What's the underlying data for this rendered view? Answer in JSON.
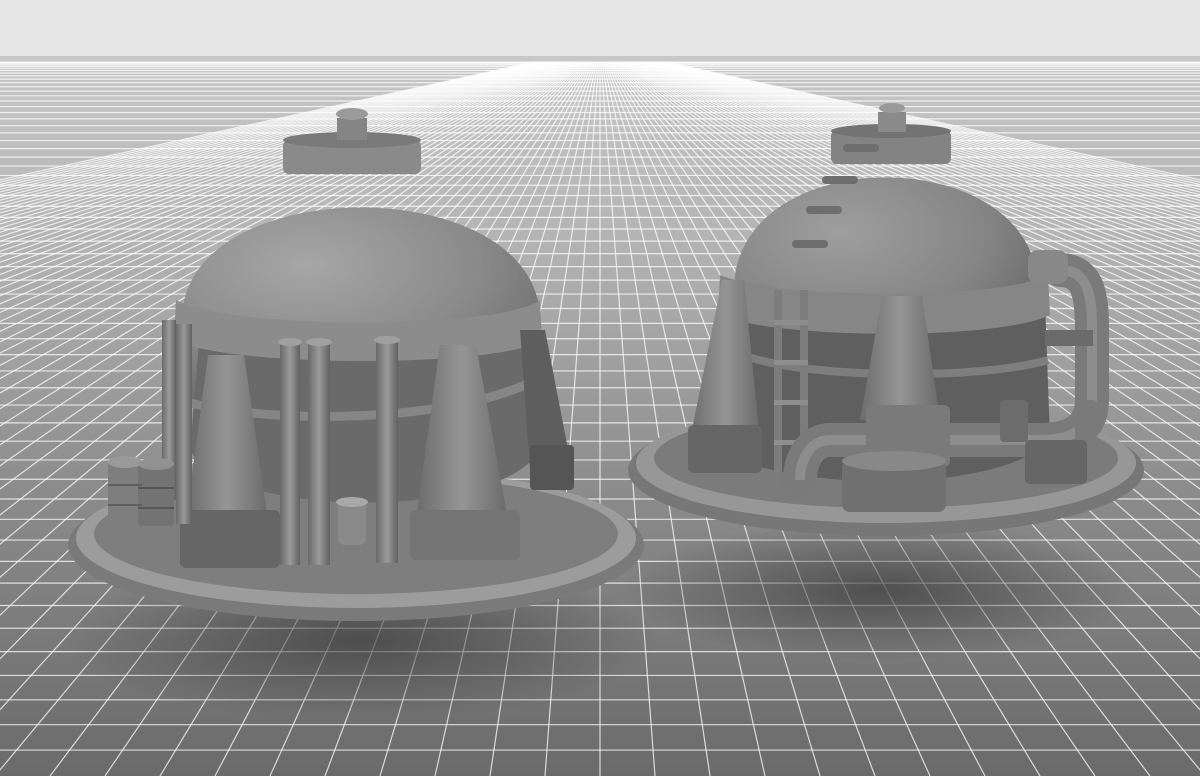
{
  "scene": {
    "subject": "two-spherical-gas-tank-models",
    "objects": [
      "left-tank-model",
      "right-tank-model"
    ],
    "colors": {
      "top_band": "#e6e6e6",
      "horizon": "#c4c4c4",
      "floor_near": "#5a5a5a",
      "grid_line": "#ffffff",
      "model_light": "#9a9a9a",
      "model_mid": "#7e7e7e",
      "model_dark": "#5c5c5c",
      "model_shadow": "#474747"
    }
  }
}
